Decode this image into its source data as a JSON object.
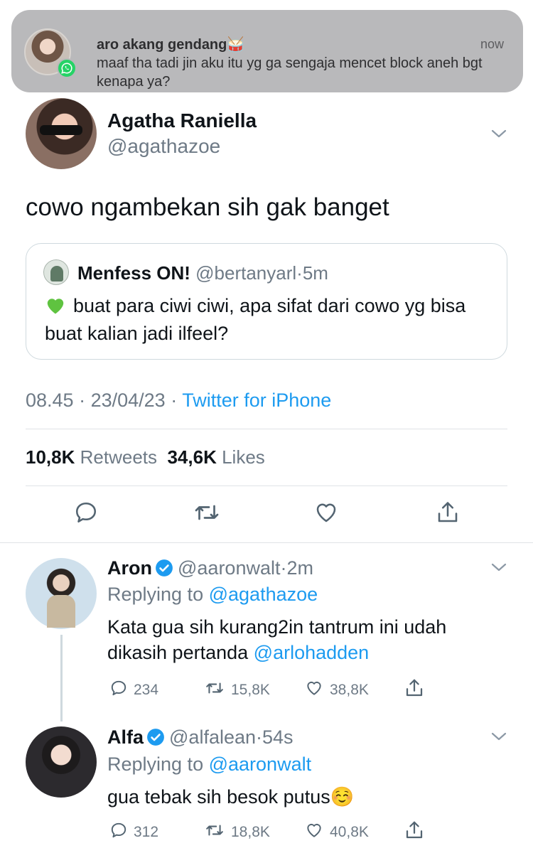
{
  "notification": {
    "title": "aro akang gendang🥁",
    "time": "now",
    "message": "maaf tha tadi jin aku itu yg ga sengaja mencet block aneh bgt kenapa ya?",
    "app_icon": "whatsapp-icon"
  },
  "tweet": {
    "display_name": "Agatha Raniella",
    "handle": "@agathazoe",
    "text": "cowo ngambekan sih gak banget",
    "quote": {
      "display_name": "Menfess ON!",
      "handle": "@bertanyarl",
      "time": "5m",
      "text": "buat para ciwi ciwi, apa sifat dari cowo yg bisa buat kalian jadi ilfeel?"
    },
    "time": "08.45",
    "date": "23/04/23",
    "source": "Twitter for iPhone",
    "retweets_count": "10,8K",
    "retweets_label": "Retweets",
    "likes_count": "34,6K",
    "likes_label": "Likes"
  },
  "replies": [
    {
      "display_name": "Aron",
      "handle": "@aaronwalt",
      "time": "2m",
      "replying_label": "Replying to",
      "replying_to": "@agathazoe",
      "text": "Kata gua sih kurang2in tantrum ini udah dikasih pertanda",
      "mention": "@arlohadden",
      "reply_count": "234",
      "retweet_count": "15,8K",
      "like_count": "38,8K"
    },
    {
      "display_name": "Alfa",
      "handle": "@alfalean",
      "time": "54s",
      "replying_label": "Replying to",
      "replying_to": "@aaronwalt",
      "text": "gua tebak sih besok putus☺️",
      "reply_count": "312",
      "retweet_count": "18,8K",
      "like_count": "40,8K"
    }
  ],
  "colors": {
    "accent": "#1d9bf0",
    "verified": "#1d9bf0",
    "secondary_text": "#6e7a86",
    "notification_bg": "#b9b9bb"
  }
}
